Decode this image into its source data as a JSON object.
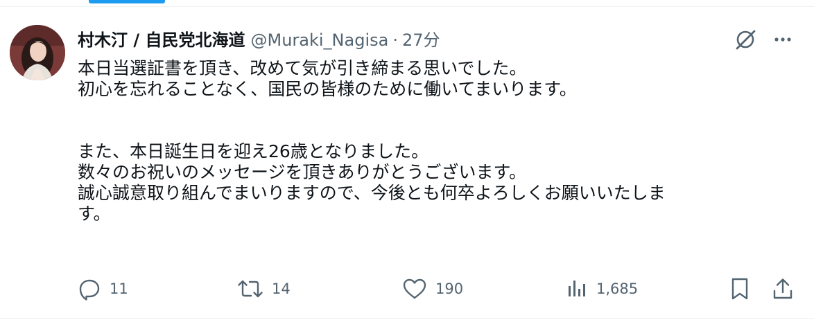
{
  "tweet": {
    "author": {
      "display_name": "村木汀 / 自民党北海道",
      "handle": "@Muraki_Nagisa",
      "separator": "·",
      "time": "27分"
    },
    "body_lines": [
      "本日当選証書を頂き、改めて気が引き締まる思いでした。",
      "初心を忘れることなく、国民の皆様のために働いてまいります。",
      "",
      "また、本日誕生日を迎え26歳となりました。",
      "数々のお祝いのメッセージを頂きありがとうございます。",
      "誠心誠意取り組んでまいりますので、今後とも何卒よろしくお願いいたしま",
      "す。"
    ],
    "stats": {
      "replies": "11",
      "reposts": "14",
      "likes": "190",
      "views": "1,685"
    }
  },
  "colors": {
    "accent": "#1d9bf0",
    "text_primary": "#0f1419",
    "text_secondary": "#536471",
    "divider": "#eff3f4"
  },
  "icons": {
    "grok": "grok-icon",
    "more": "more-icon",
    "reply": "reply-icon",
    "repost": "repost-icon",
    "like": "heart-icon",
    "views": "views-icon",
    "bookmark": "bookmark-icon",
    "share": "share-icon"
  }
}
